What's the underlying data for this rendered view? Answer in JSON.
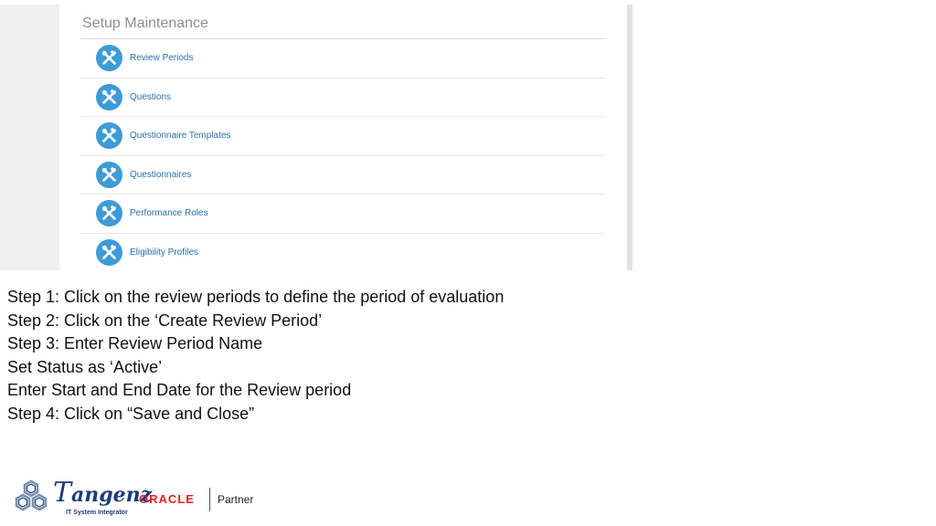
{
  "panel": {
    "title": "Setup Maintenance",
    "items": [
      {
        "label": "Review Periods",
        "icon": "tools-icon"
      },
      {
        "label": "Questions",
        "icon": "tools-icon"
      },
      {
        "label": "Questionnaire Templates",
        "icon": "tools-icon"
      },
      {
        "label": "Questionnaires",
        "icon": "tools-icon"
      },
      {
        "label": "Performance Roles",
        "icon": "tools-icon"
      },
      {
        "label": "Eligibility Profiles",
        "icon": "tools-icon"
      }
    ]
  },
  "instructions": [
    "Step 1: Click on the review periods to define the period of evaluation",
    "Step 2: Click on the ‘Create Review Period’",
    "Step 3: Enter Review Period Name",
    "Set Status as ‘Active’",
    "Enter Start and End Date for the Review period",
    "Step 4: Click on “Save and Close”"
  ],
  "footer": {
    "brand": "angenz",
    "tagline": "IT System Integrator",
    "oracle": "ORACLE",
    "partner": "Partner"
  },
  "colors": {
    "icon_bg": "#3d9bd6",
    "link": "#2a6fb0",
    "oracle_red": "#e2231a",
    "brand_blue": "#1d3c78"
  }
}
